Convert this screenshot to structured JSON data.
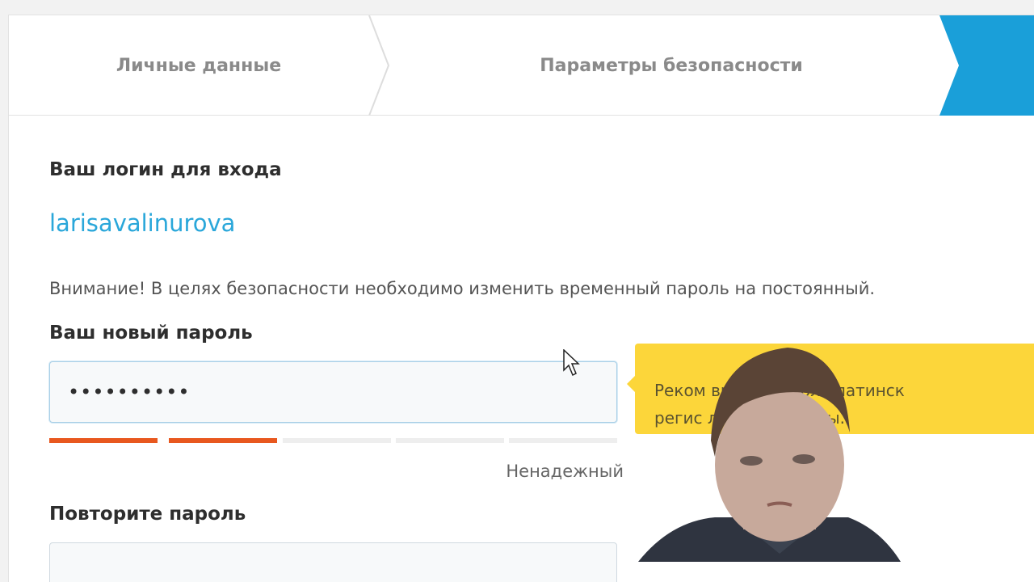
{
  "stepper": {
    "steps": [
      {
        "label": "Личные данные"
      },
      {
        "label": "Параметры безопасности"
      },
      {
        "label": ""
      }
    ],
    "active_color": "#1a9fd9"
  },
  "login": {
    "label": "Ваш логин для входа",
    "value": "larisavalinurova"
  },
  "notice": "Внимание! В целях безопасности необходимо изменить временный пароль на постоянный.",
  "new_password": {
    "label": "Ваш новый пароль",
    "value": "••••••••••",
    "strength": {
      "segments_total": 5,
      "segments_filled": 2,
      "text": "Ненадежный",
      "color": "#e8581f"
    }
  },
  "tooltip": {
    "line1": "Реком                      вить в пароль латинск",
    "line2": "регис                   льные символы."
  },
  "repeat_password": {
    "label": "Повторите пароль",
    "value": ""
  },
  "icons": {
    "cursor": "mouse-pointer-icon"
  }
}
